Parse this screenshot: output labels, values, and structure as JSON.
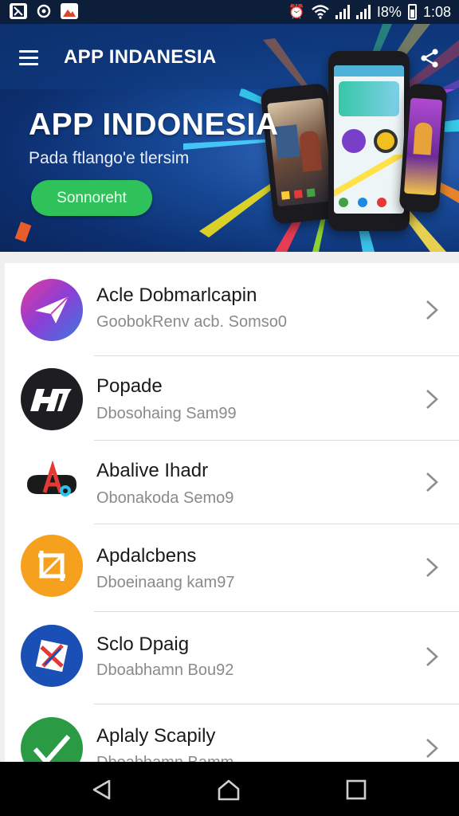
{
  "status_bar": {
    "notification_icons": [
      "app-notification-icon",
      "sync-icon",
      "gallery-icon"
    ],
    "alarm_glyph": "⏰",
    "battery_text": "I8%",
    "time": "1:08"
  },
  "toolbar": {
    "title": "APP INDANESIA",
    "menu_icon": "hamburger-menu-icon",
    "share_icon": "share-icon"
  },
  "hero": {
    "title": "APP INDONESIA",
    "subtitle": "Pada ftlango'e tlersim",
    "button_label": "Sonnoreht"
  },
  "apps": [
    {
      "title": "Acle Dobmarlcapin",
      "subtitle": "GoobokRenv acb. Somso0",
      "icon": "paper-plane-icon",
      "colors": [
        "#e43a9b",
        "#3a7ae0"
      ]
    },
    {
      "title": "Popade",
      "subtitle": "Dbosohaing Sam99",
      "icon": "h7-logo-icon",
      "colors": [
        "#222",
        "#222"
      ]
    },
    {
      "title": "Abalive Ihadr",
      "subtitle": "Obonakoda Semo9",
      "icon": "tiktok-style-icon",
      "colors": [
        "#ffffff",
        "#ffffff"
      ]
    },
    {
      "title": "Apdalcbens",
      "subtitle": "Dboeinaang kam97",
      "icon": "crop-icon",
      "colors": [
        "#f5a623",
        "#f29a10"
      ]
    },
    {
      "title": "Sclo Dpaig",
      "subtitle": "Dboabhamn Bou92",
      "icon": "x-logo-icon",
      "colors": [
        "#1a4fb5",
        "#1a4fb5"
      ]
    },
    {
      "title": "Aplaly Scapily",
      "subtitle": "Dboabhamn Bamm",
      "icon": "check-leaf-icon",
      "colors": [
        "#2e9b46",
        "#1f8a3c"
      ]
    }
  ],
  "navigation": {
    "back": "back-triangle-icon",
    "home": "home-icon",
    "recents": "recents-square-icon"
  }
}
